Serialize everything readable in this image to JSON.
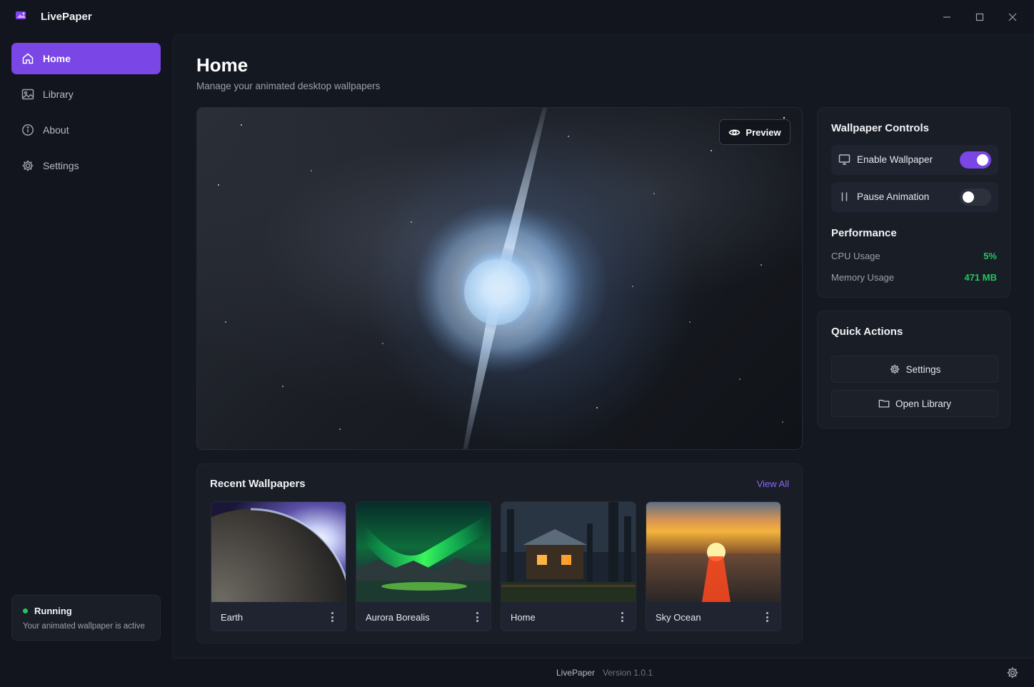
{
  "app": {
    "title": "LivePaper"
  },
  "sidebar": {
    "items": [
      {
        "label": "Home",
        "icon": "home-icon",
        "active": true
      },
      {
        "label": "Library",
        "icon": "image-icon",
        "active": false
      },
      {
        "label": "About",
        "icon": "info-icon",
        "active": false
      },
      {
        "label": "Settings",
        "icon": "gear-icon",
        "active": false
      }
    ],
    "status": {
      "title": "Running",
      "subtitle": "Your animated wallpaper is active",
      "color": "#22c55e"
    }
  },
  "page": {
    "title": "Home",
    "subtitle": "Manage your animated desktop wallpapers"
  },
  "preview": {
    "button_label": "Preview",
    "icon": "eye-icon"
  },
  "controls": {
    "title": "Wallpaper Controls",
    "enable": {
      "label": "Enable Wallpaper",
      "on": true,
      "icon": "monitor-icon"
    },
    "pause": {
      "label": "Pause Animation",
      "on": false,
      "icon": "pause-icon"
    }
  },
  "performance": {
    "title": "Performance",
    "cpu": {
      "label": "CPU Usage",
      "value": "5%"
    },
    "memory": {
      "label": "Memory Usage",
      "value": "471 MB"
    }
  },
  "quick_actions": {
    "title": "Quick Actions",
    "settings_label": "Settings",
    "library_label": "Open Library"
  },
  "recent": {
    "title": "Recent Wallpapers",
    "view_all": "View All",
    "items": [
      {
        "label": "Earth"
      },
      {
        "label": "Aurora Borealis"
      },
      {
        "label": "Home"
      },
      {
        "label": "Sky Ocean"
      }
    ]
  },
  "footer": {
    "app": "LivePaper",
    "version": "Version 1.0.1"
  },
  "colors": {
    "accent": "#7a46e6",
    "success": "#22c55e",
    "link": "#8b67f5"
  }
}
